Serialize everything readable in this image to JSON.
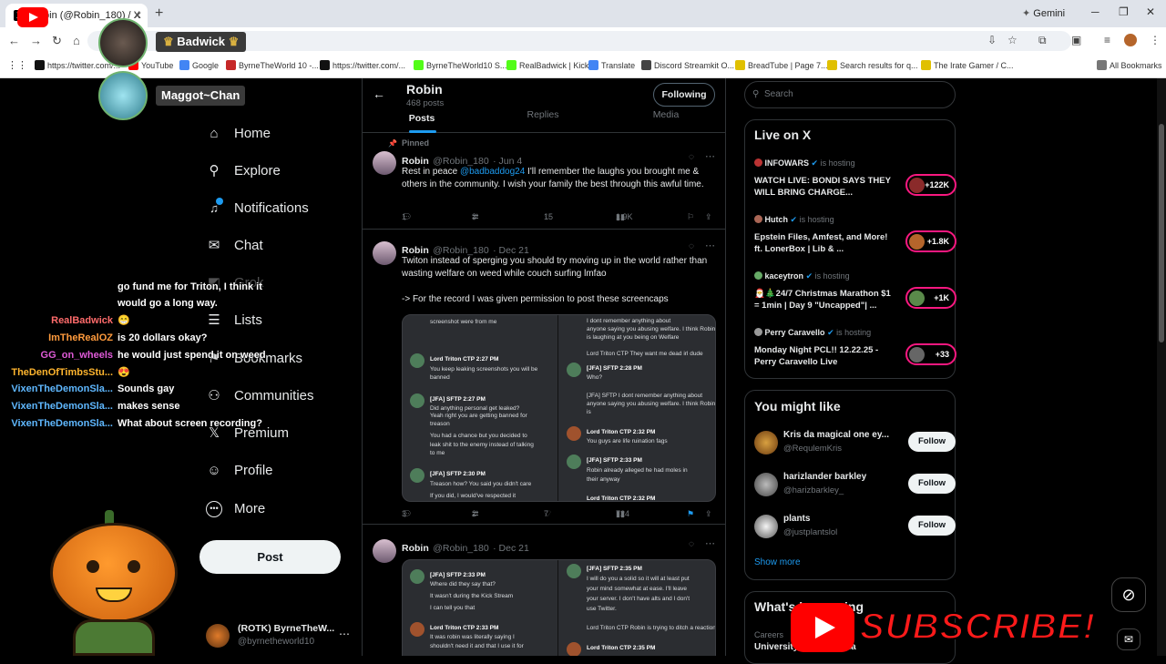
{
  "browser": {
    "tab_title": "Robin (@Robin_180) / X",
    "new_tab": "+",
    "gemini_label": "Gemini",
    "bookmarks": [
      {
        "label": "https://twitter.com/...",
        "color": "#111111"
      },
      {
        "label": "YouTube",
        "color": "#ff0000"
      },
      {
        "label": "Google",
        "color": "#4285f4"
      },
      {
        "label": "ByrneTheWorld 10 -...",
        "color": "#c62828"
      },
      {
        "label": "https://twitter.com/...",
        "color": "#111111"
      },
      {
        "label": "ByrneTheWorld10 S...",
        "color": "#53fc18"
      },
      {
        "label": "RealBadwick | Kick",
        "color": "#53fc18"
      },
      {
        "label": "Translate",
        "color": "#4285f4"
      },
      {
        "label": "Discord Streamkit O...",
        "color": "#444444"
      },
      {
        "label": "BreadTube | Page 7...",
        "color": "#e0c000"
      },
      {
        "label": "Search results for q...",
        "color": "#e0c000"
      },
      {
        "label": "The Irate Gamer / C...",
        "color": "#e0c000"
      }
    ],
    "all_bookmarks": "All Bookmarks"
  },
  "overlay": {
    "badwick_label": "Badwick",
    "maggot_label": "Maggot~Chan",
    "subscribe_text": "SUBSCRIBE!"
  },
  "chat": [
    {
      "user": "",
      "message": "go fund me for Triton, I think it",
      "color": "#ffffff"
    },
    {
      "user": "",
      "message": "would go a long way.",
      "color": "#ffffff"
    },
    {
      "user": "RealBadwick",
      "message": "😁",
      "color": "#ff6b6b"
    },
    {
      "user": "ImTheRealOZ",
      "message": "is 20 dollars okay?",
      "color": "#ff9b3d"
    },
    {
      "user": "GG_on_wheels",
      "message": "he would just spend it on weed",
      "color": "#e05bd8"
    },
    {
      "user": "TheDenOfTimbsStu...",
      "message": "😍",
      "color": "#ffb52e"
    },
    {
      "user": "VixenTheDemonSla...",
      "message": "Sounds gay",
      "color": "#5fb8ff"
    },
    {
      "user": "VixenTheDemonSla...",
      "message": "makes sense",
      "color": "#5fb8ff"
    },
    {
      "user": "VixenTheDemonSla...",
      "message": "What about screen recording?",
      "color": "#5fb8ff"
    }
  ],
  "left_nav": {
    "items": [
      {
        "label": "Home",
        "icon": "home-icon",
        "glyph": "⌂"
      },
      {
        "label": "Explore",
        "icon": "search-icon",
        "glyph": "⚲"
      },
      {
        "label": "Notifications",
        "icon": "bell-icon",
        "glyph": "🔔"
      },
      {
        "label": "Chat",
        "icon": "mail-icon",
        "glyph": "✉"
      },
      {
        "label": "Grok",
        "icon": "grok-icon",
        "glyph": "◩"
      },
      {
        "label": "Lists",
        "icon": "lists-icon",
        "glyph": "☰"
      },
      {
        "label": "Bookmarks",
        "icon": "bookmark-icon",
        "glyph": "⚑"
      },
      {
        "label": "Communities",
        "icon": "communities-icon",
        "glyph": "⚇"
      },
      {
        "label": "Premium",
        "icon": "x-logo-icon",
        "glyph": "𝕏"
      },
      {
        "label": "Profile",
        "icon": "profile-icon",
        "glyph": "☺"
      },
      {
        "label": "More",
        "icon": "more-icon",
        "glyph": "⋯"
      }
    ],
    "post_button": "Post",
    "account_name": "(ROTK) ByrneTheW...",
    "account_handle": "@byrnetheworld10"
  },
  "profile": {
    "name": "Robin",
    "posts_count": "468 posts",
    "following_button": "Following",
    "tabs": [
      "Posts",
      "Replies",
      "Media"
    ]
  },
  "tweets": [
    {
      "pinned_label": "Pinned",
      "name": "Robin",
      "handle": "@Robin_180",
      "date": "· Jun 4",
      "mention": "@badbaddog24",
      "text_before": "Rest in peace ",
      "text_after": " I'll remember the laughs you brought me & others in the community. I wish your family the best through this awful time.",
      "replies": "1",
      "reposts": "3",
      "likes": "15",
      "views": "1.9K"
    },
    {
      "name": "Robin",
      "handle": "@Robin_180",
      "date": "· Dec 21",
      "text": "Twiton instead of sperging you should try moving up in the world rather than wasting welfare on weed while couch surfing lmfao",
      "text2": "-> For the record I was given permission to post these screencaps",
      "replies": "3",
      "reposts": "2",
      "likes": "7",
      "views": "724"
    },
    {
      "name": "Robin",
      "handle": "@Robin_180",
      "date": "· Dec 21"
    }
  ],
  "screencaps": {
    "a": [
      "screenshot were from me",
      "Lord Triton  CTP 2:27 PM",
      "You keep leaking screenshots you will be",
      "banned",
      "[JFA]  SFTP 2:27 PM",
      "Did anything personal get leaked?",
      "Yeah right you are getting banned for",
      "treason",
      "You had a chance but you decided to",
      "leak shit to the enemy instead of talking",
      "to me",
      "[JFA]  SFTP 2:30 PM",
      "Treason how? You said you didn't care",
      "If you did, I would've respected it"
    ],
    "b": [
      "I dont remember anything about",
      "anyone saying you abusing welfare. I think Robin",
      "is laughing at you being on Welfare",
      "Lord Triton  CTP  They want me dead irl dude",
      "[JFA]  SFTP 2:28 PM",
      "Who?",
      "[JFA]  SFTP  I dont remember anything about",
      "anyone saying you abusing welfare. I think Robin is",
      "Lord Triton  CTP 2:32 PM",
      "You guys are life ruination fags",
      "[JFA]  SFTP 2:33 PM",
      "Robin already alleged he had moles in",
      "their anyway",
      "Lord Triton  CTP 2:32 PM"
    ],
    "c": [
      "[JFA]  SFTP 2:33 PM",
      "Where did they say that?",
      "It wasn't during the Kick Stream",
      "I can tell you that",
      "Lord Triton  CTP 2:33 PM",
      "It was robin was literally saying I",
      "shouldn't need it and that I use it for"
    ],
    "d": [
      "[JFA]  SFTP 2:35 PM",
      "I will do you a solid so it will at least put",
      "your mind somewhat at ease. I'll leave",
      "your server. I don't have alts and I don't",
      "use Twitter.",
      "Lord Triton  CTP  Robin is trying to ditch a reaction",
      "Lord Triton  CTP 2:35 PM"
    ]
  },
  "right": {
    "search_placeholder": "Search",
    "live_title": "Live on X",
    "hosting_label": "is hosting",
    "live": [
      {
        "host": "INFOWARS",
        "title": "WATCH LIVE: BONDI SAYS THEY WILL BRING CHARGE...",
        "count": "+122K"
      },
      {
        "host": "Hutch",
        "title": "Epstein Files, Amfest, and More! ft. LonerBox | Lib & ...",
        "count": "+1.8K"
      },
      {
        "host": "kaceytron",
        "title": "🎅🎄24/7 Christmas Marathon $1 = 1min | Day 9 \"Uncapped\"| ...",
        "count": "+1K"
      },
      {
        "host": "Perry Caravello",
        "title": "Monday Night PCL!! 12.22.25 - Perry Caravello Live",
        "count": "+33"
      }
    ],
    "might_like_title": "You might like",
    "suggestions": [
      {
        "name": "Kris da magical one ey...",
        "handle": "@RequlemKris",
        "button": "Follow"
      },
      {
        "name": "harizlander barkley",
        "handle": "@harizbarkley_",
        "button": "Follow"
      },
      {
        "name": "plants",
        "handle": "@justplantslol",
        "button": "Follow"
      }
    ],
    "show_more": "Show more",
    "trending_title": "What's happening",
    "trend_category": "Careers",
    "trend_name": "University of Oklahoma"
  }
}
